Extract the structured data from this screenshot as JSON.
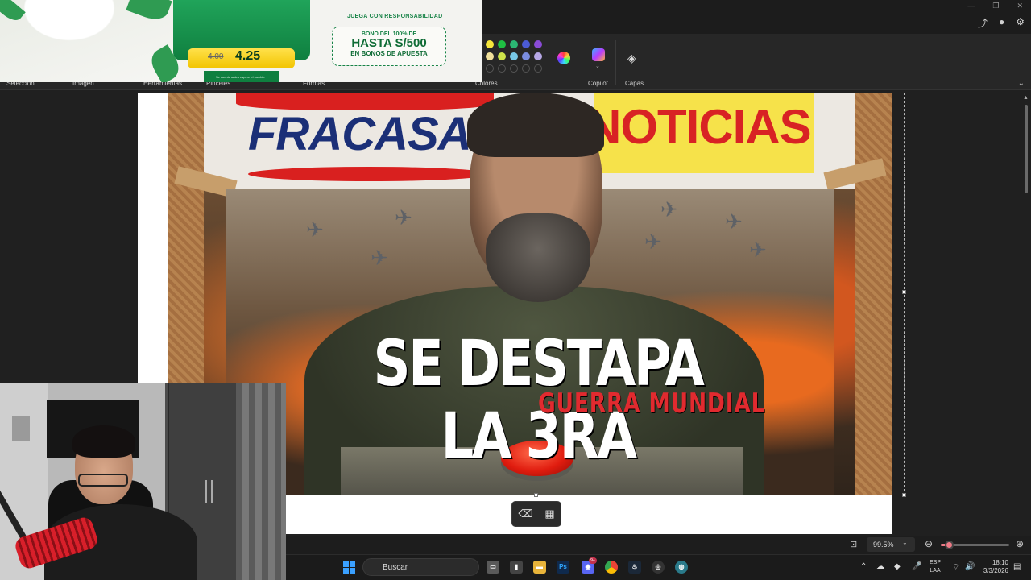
{
  "ribbon": {
    "labels": [
      "Selección",
      "Imagen",
      "Herramientas",
      "Pinceles",
      "Formas",
      "Colores",
      "Copilot",
      "Capas"
    ],
    "palette_row1": [
      "#f5e63b",
      "#1fbf43",
      "#2bb673",
      "#4b5bd6",
      "#8a4bd6"
    ],
    "palette_row2": [
      "#f0e09a",
      "#cde34a",
      "#78c8e6",
      "#7a8de0",
      "#b7a8e6"
    ]
  },
  "ad": {
    "odds_old": "4.00",
    "odds_new": "4.25",
    "fine_print": "Se cuenta antes espere el cambio",
    "responsibility": "JUEGA CON RESPONSABILIDAD",
    "bonus_line1": "BONO DEL 100% DE",
    "bonus_line2": "HASTA S/500",
    "bonus_line3": "EN BONOS DE APUESTA"
  },
  "thumbnail": {
    "title_left": "FRACASAD",
    "title_right": "NOTICIAS",
    "headline": "SE DESTAPA LA 3RA",
    "subheadline": "GUERRA MUNDIAL"
  },
  "status": {
    "zoom": "99.5%",
    "zoom_slider_fraction": 0.12
  },
  "taskbar": {
    "search_placeholder": "Buscar",
    "badge_count": "9+",
    "lang_line1": "ESP",
    "lang_line2": "LAA",
    "time": "18:10",
    "date": "3/3/2026"
  },
  "colors": {
    "accent": "#ef7a86",
    "start_blue": "#3aa0ff"
  }
}
